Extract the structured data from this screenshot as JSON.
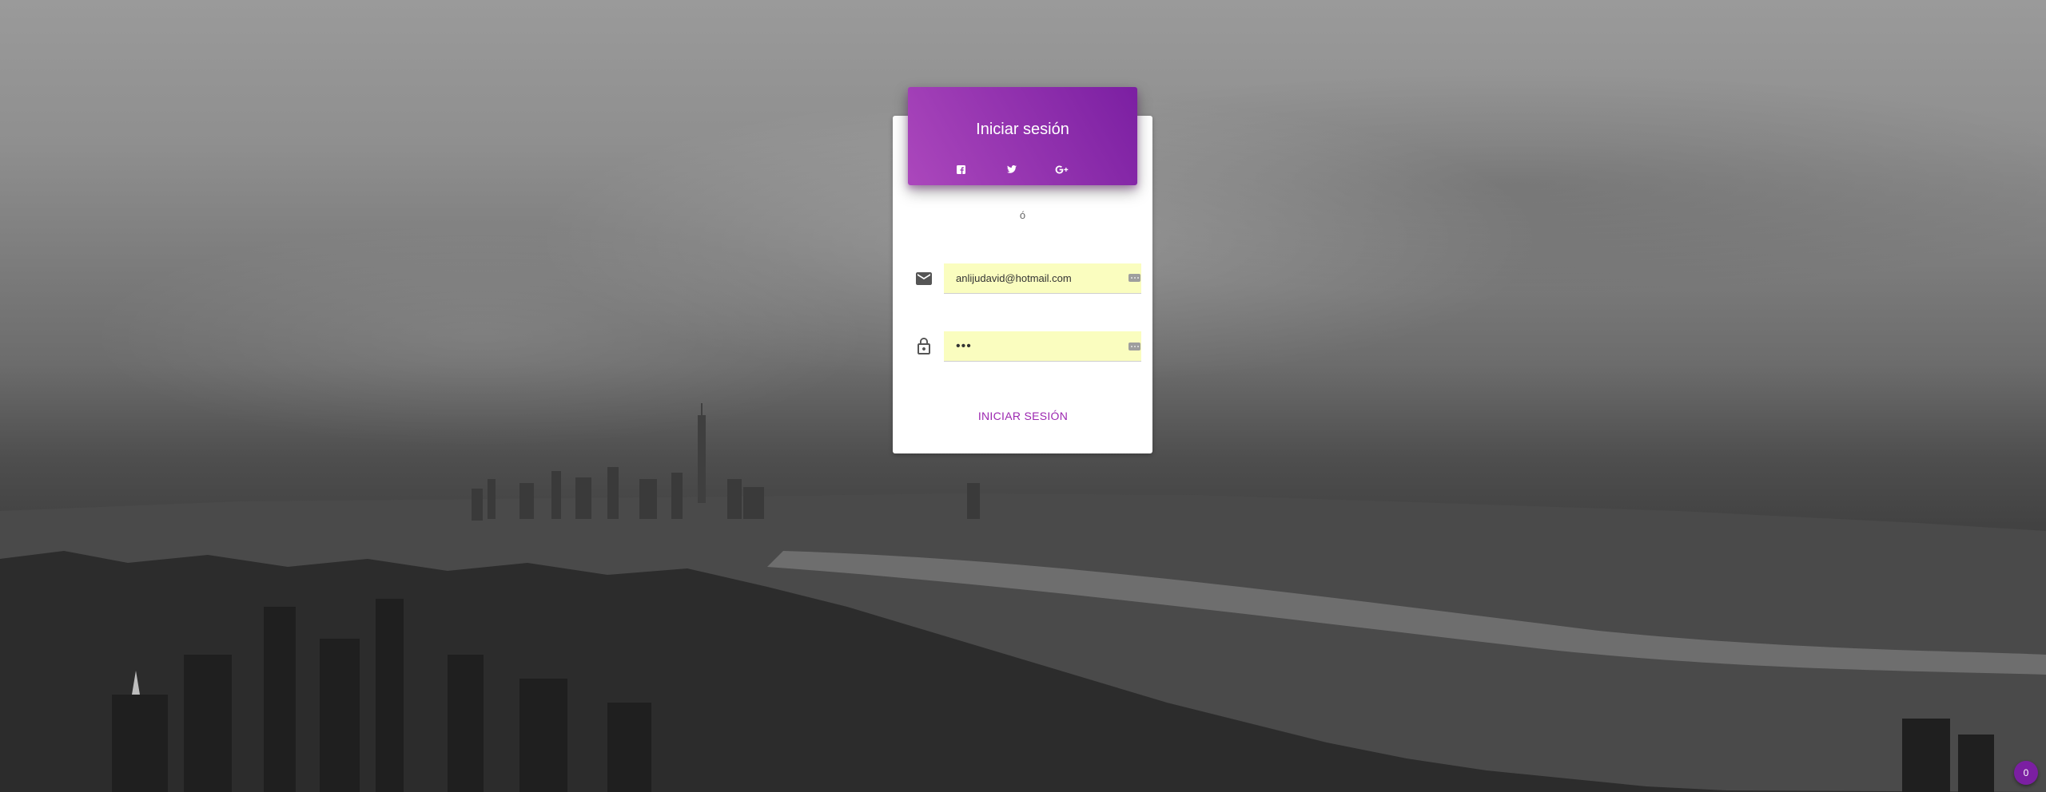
{
  "login": {
    "title": "Iniciar sesión",
    "divider": "ó",
    "email_value": "anlijudavid@hotmail.com",
    "password_value": "•••",
    "submit_label": "INICIAR SESIÓN"
  },
  "social": {
    "icons": [
      "facebook-icon",
      "twitter-icon",
      "google-plus-icon"
    ]
  },
  "badge": {
    "count": "0"
  },
  "colors": {
    "accent": "#9c27b0",
    "header_start": "#ab47bc",
    "header_end": "#7b1fa2",
    "autofill_bg": "#fafdbf"
  }
}
